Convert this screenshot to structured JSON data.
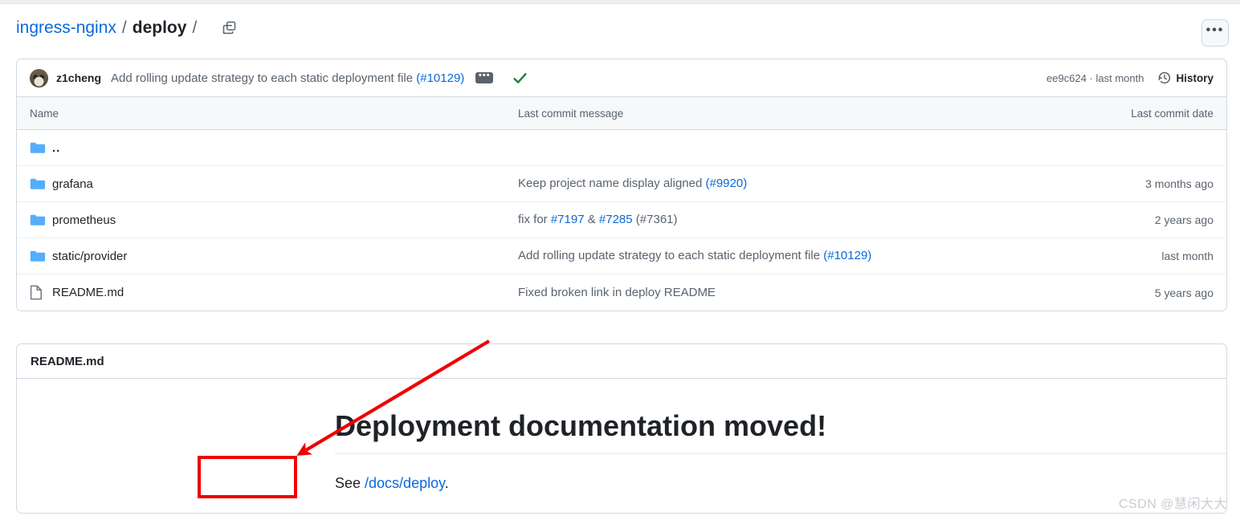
{
  "colors": {
    "link": "#0969da",
    "text": "#1f2328",
    "muted": "#59636e",
    "border": "#d1d9e0",
    "folder": "#54aeff",
    "success": "#1a7f37",
    "annotation": "#ee0000"
  },
  "header": {
    "breadcrumb": {
      "repo": "ingress-nginx",
      "sep": "/",
      "path": "deploy",
      "trailing_sep": "/"
    },
    "copy_path_icon": "copy-icon",
    "more_options_label": "•••"
  },
  "commit_bar": {
    "avatar_alt": "z1cheng",
    "author": "z1cheng",
    "message_prefix": "Add rolling update strategy to each static deployment file ",
    "message_ref": "(#10129)",
    "expand_label": "•••",
    "status_icon": "check-icon",
    "sha": "ee9c624",
    "separator": " · ",
    "relative_date": "last month",
    "history_icon": "history-clock-icon",
    "history_label": "History"
  },
  "file_table": {
    "columns": {
      "name": "Name",
      "message": "Last commit message",
      "date": "Last commit date"
    },
    "rows": [
      {
        "icon": "folder-icon",
        "type": "directory",
        "name": "..",
        "message_prefix": "",
        "message_ref": "",
        "message_suffix": "",
        "date": ""
      },
      {
        "icon": "folder-icon",
        "type": "directory",
        "name": "grafana",
        "message_prefix": "Keep project name display aligned ",
        "message_ref": "(#9920)",
        "message_suffix": "",
        "date": "3 months ago"
      },
      {
        "icon": "folder-icon",
        "type": "directory",
        "name": "prometheus",
        "message_prefix": "fix for ",
        "message_ref": "#7197",
        "message_mid": " & ",
        "message_ref2": "#7285",
        "message_suffix": " (#7361)",
        "date": "2 years ago"
      },
      {
        "icon": "folder-icon",
        "type": "directory",
        "name": "static/provider",
        "message_prefix": "Add rolling update strategy to each static deployment file ",
        "message_ref": "(#10129)",
        "message_suffix": "",
        "date": "last month"
      },
      {
        "icon": "file-icon",
        "type": "file",
        "name": "README.md",
        "message_prefix": "Fixed broken link in deploy README",
        "message_ref": "",
        "message_suffix": "",
        "date": "5 years ago"
      }
    ]
  },
  "readme": {
    "panel_title": "README.md",
    "heading": "Deployment documentation moved!",
    "paragraph_prefix": "See ",
    "paragraph_link": "/docs/deploy",
    "paragraph_suffix": "."
  },
  "annotations": {
    "highlight_box_target": "/docs/deploy link",
    "arrow_color": "#ee0000"
  },
  "watermark": {
    "text": "CSDN @慧闲大大"
  }
}
